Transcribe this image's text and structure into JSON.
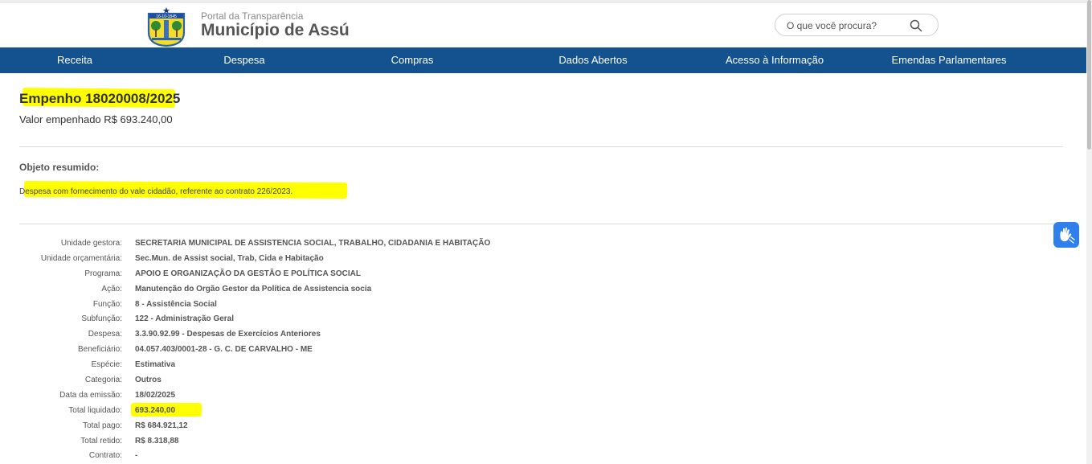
{
  "brand": {
    "portal": "Portal da Transparência",
    "municipio": "Município de Assú",
    "logo_date": "16-10-1845"
  },
  "search": {
    "placeholder": "O que você procura?",
    "icon": "search-icon"
  },
  "nav": [
    "Receita",
    "Despesa",
    "Compras",
    "Dados Abertos",
    "Acesso à Informação",
    "Emendas Parlamentares"
  ],
  "empenho": {
    "title": "Empenho 18020008/2025",
    "valor": "Valor empenhado R$ 693.240,00",
    "objeto_label": "Objeto resumido:",
    "objeto_text": "Despesa com fornecimento do vale cidadão, referente ao contrato 226/2023."
  },
  "details": [
    {
      "label": "Unidade gestora:",
      "value": "SECRETARIA MUNICIPAL DE ASSISTENCIA SOCIAL, TRABALHO, CIDADANIA E HABITAÇÃO"
    },
    {
      "label": "Unidade orçamentária:",
      "value": "Sec.Mun. de Assist social, Trab, Cida e Habitação"
    },
    {
      "label": "Programa:",
      "value": "APOIO E ORGANIZAÇÃO DA GESTÃO E POLÍTICA SOCIAL"
    },
    {
      "label": "Ação:",
      "value": "Manutenção do Orgão Gestor da Política de Assistencia socia"
    },
    {
      "label": "Função:",
      "value": "8 - Assistência Social"
    },
    {
      "label": "Subfunção:",
      "value": "122 - Administração Geral"
    },
    {
      "label": "Despesa:",
      "value": "3.3.90.92.99 - Despesas de Exercícios Anteriores"
    },
    {
      "label": "Beneficiário:",
      "value": "04.057.403/0001-28 - G. C. DE CARVALHO - ME"
    },
    {
      "label": "Espécie:",
      "value": "Estimativa"
    },
    {
      "label": "Categoria:",
      "value": "Outros"
    },
    {
      "label": "Data da emissão:",
      "value": "18/02/2025"
    },
    {
      "label": "Total liquidado:",
      "value": "693.240,00"
    },
    {
      "label": "Total pago:",
      "value": "R$ 684.921,12"
    },
    {
      "label": "Total retido:",
      "value": "R$ 8.318,88"
    },
    {
      "label": "Contrato:",
      "value": "-"
    }
  ],
  "accessibility_button": {
    "icon": "sign-language-icon"
  },
  "colors": {
    "nav_bg": "#13528f",
    "highlight": "#ffff00",
    "a11y_bg": "#2f80ed"
  }
}
